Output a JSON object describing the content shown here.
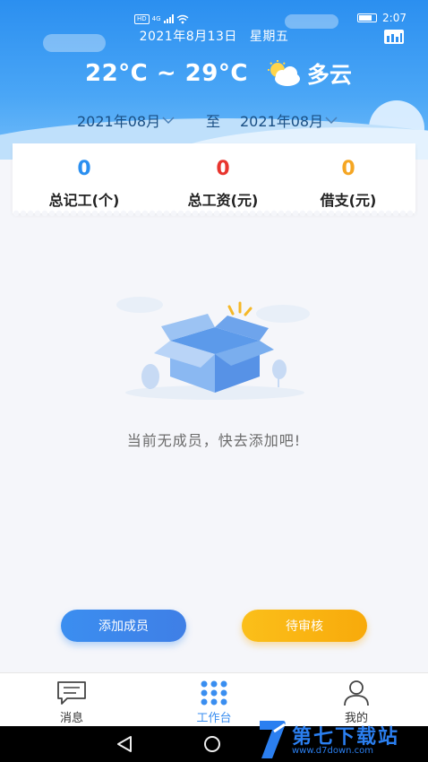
{
  "status_bar": {
    "network": "4G",
    "time": "2:07"
  },
  "header": {
    "date": "2021年8月13日",
    "weekday": "星期五",
    "temperature": "22°C ~ 29°C",
    "weather": "多云"
  },
  "date_range": {
    "start": "2021年08月",
    "separator": "至",
    "end": "2021年08月"
  },
  "summary": [
    {
      "value": "0",
      "label": "总记工(个)",
      "color": "#2b8ff0"
    },
    {
      "value": "0",
      "label": "总工资(元)",
      "color": "#e8352e"
    },
    {
      "value": "0",
      "label": "借支(元)",
      "color": "#f5a623"
    }
  ],
  "empty_state": {
    "message": "当前无成员，快去添加吧!"
  },
  "actions": {
    "add_member": "添加成员",
    "pending_review": "待审核"
  },
  "tabbar": {
    "messages": "消息",
    "workbench": "工作台",
    "mine": "我的"
  },
  "watermark": {
    "text": "第七下载站",
    "url": "www.d7down.com"
  },
  "colors": {
    "accent": "#2b8ff0",
    "orange": "#f8aa0b"
  }
}
